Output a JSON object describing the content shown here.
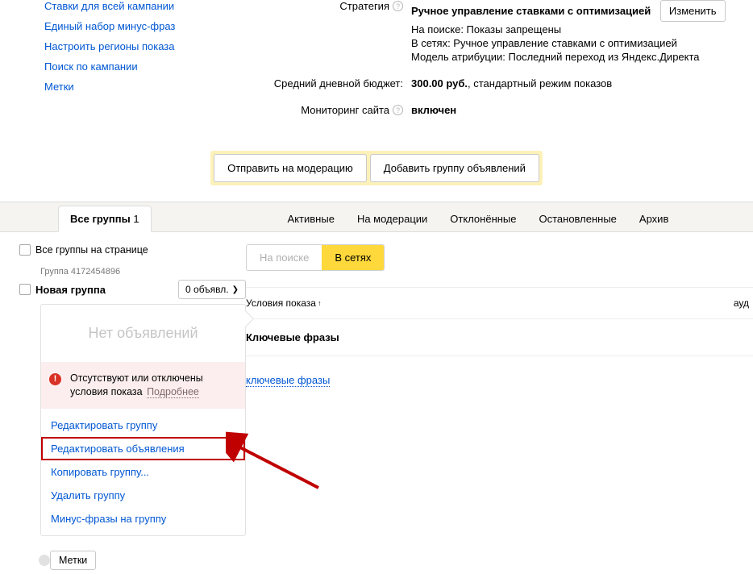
{
  "sidebar": {
    "items": [
      "Ставки для всей кампании",
      "Единый набор минус-фраз",
      "Настроить регионы показа",
      "Поиск по кампании",
      "Метки"
    ]
  },
  "params": {
    "strategy_label": "Стратегия",
    "strategy_value": "Ручное управление ставками с оптимизацией",
    "change": "Изменить",
    "sub1": "На поиске: Показы запрещены",
    "sub2": "В сетях: Ручное управление ставками с оптимизацией",
    "sub3": "Модель атрибуции: Последний переход из Яндекс.Директа",
    "budget_label": "Средний дневной бюджет:",
    "budget_value": "300.00 руб.",
    "budget_mode": ", стандартный режим показов",
    "monitoring_label": "Мониторинг сайта",
    "monitoring_value": "включен"
  },
  "actions": {
    "moderate": "Отправить на модерацию",
    "add_group": "Добавить группу объявлений"
  },
  "tabs": {
    "all": "Все группы",
    "all_count": "1",
    "active": "Активные",
    "moderation": "На модерации",
    "rejected": "Отклонённые",
    "stopped": "Остановленные",
    "archive": "Архив"
  },
  "left": {
    "all_on_page": "Все группы на странице",
    "group_id": "Группа 4172454896",
    "group_name": "Новая группа",
    "ads_count": "0 объявл.",
    "no_ads": "Нет объявлений",
    "warn_text": "Отсутствуют или отключены условия показа",
    "warn_more": "Подробнее",
    "menu": {
      "edit_group": "Редактировать группу",
      "edit_ads": "Редактировать объявления",
      "copy": "Копировать группу...",
      "del": "Удалить группу",
      "minus": "Минус-фразы на группу"
    },
    "tags": "Метки"
  },
  "right": {
    "search_tab": "На поиске",
    "network_tab": "В сетях",
    "cond_title": "Условия показа",
    "aud": "ауд",
    "key_head": "Ключевые фразы",
    "key_link": "ключевые фразы"
  }
}
